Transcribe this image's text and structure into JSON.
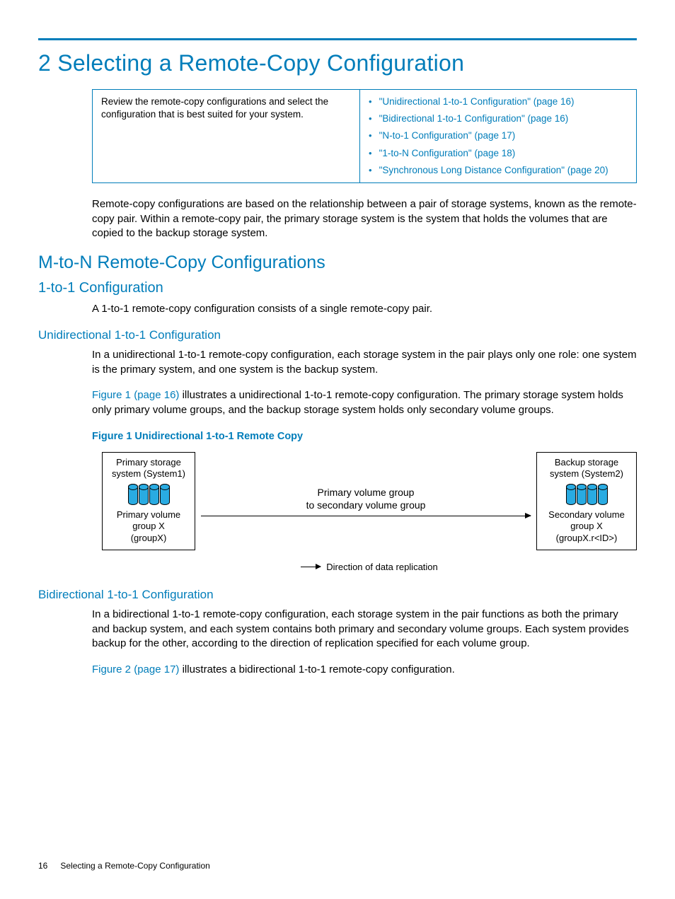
{
  "chapter_title": "2 Selecting a Remote-Copy Configuration",
  "info_box": {
    "intro": "Review the remote-copy configurations and select the configuration that is best suited for your system.",
    "links": [
      "\"Unidirectional 1-to-1 Configuration\" (page 16)",
      "\"Bidirectional 1-to-1 Configuration\" (page 16)",
      "\"N-to-1 Configuration\" (page 17)",
      "\"1-to-N Configuration\" (page 18)",
      "\"Synchronous Long Distance Configuration\" (page 20)"
    ]
  },
  "para_intro": "Remote-copy configurations are based on the relationship between a pair of storage systems, known as the remote-copy pair. Within a remote-copy pair, the primary storage system is the system that holds the volumes that are copied to the backup storage system.",
  "h2_mton": "M-to-N Remote-Copy Configurations",
  "h3_1to1": "1-to-1 Configuration",
  "para_1to1": "A 1-to-1 remote-copy configuration consists of a single remote-copy pair.",
  "h4_uni": "Unidirectional 1-to-1 Configuration",
  "para_uni1": "In a unidirectional 1-to-1 remote-copy configuration, each storage system in the pair plays only one role: one system is the primary system, and one system is the backup system.",
  "link_fig1": "Figure 1 (page 16)",
  "para_uni2_rest": " illustrates a unidirectional 1-to-1 remote-copy configuration. The primary storage system holds only primary volume groups, and the backup storage system holds only secondary volume groups.",
  "fig1_caption": "Figure 1 Unidirectional 1-to-1 Remote Copy",
  "fig1": {
    "left_top": "Primary storage\nsystem (System1)",
    "left_bottom": "Primary volume\ngroup X\n(groupX)",
    "arrow_label": "Primary volume group\nto secondary volume group",
    "right_top": "Backup storage\nsystem (System2)",
    "right_bottom": "Secondary volume\ngroup X\n(groupX.r<ID>)",
    "legend": "Direction of data replication"
  },
  "h4_bi": "Bidirectional 1-to-1 Configuration",
  "para_bi1": "In a bidirectional 1-to-1 remote-copy configuration, each storage system in the pair functions as both the primary and backup system, and each system contains both primary and secondary volume groups. Each system provides backup for the other, according to the direction of replication specified for each volume group.",
  "link_fig2": "Figure 2 (page 17)",
  "para_bi2_rest": " illustrates a bidirectional 1-to-1 remote-copy configuration.",
  "footer": {
    "page": "16",
    "title": "Selecting a Remote-Copy Configuration"
  }
}
